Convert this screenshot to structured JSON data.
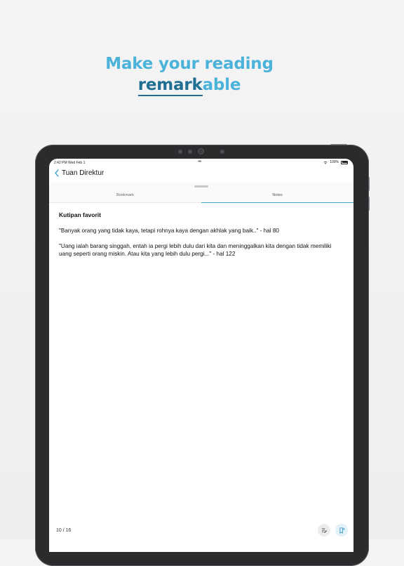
{
  "headline": {
    "line1": "Make your reading",
    "line2_mark": "remark",
    "line2_rest": "able"
  },
  "status_bar": {
    "time": "2:42 PM  Wed Feb 1",
    "dots": "•••",
    "battery": "100%"
  },
  "nav": {
    "title": "Tuan Direktur"
  },
  "tabs": [
    {
      "label": "Bookmark",
      "active": false
    },
    {
      "label": "Notes",
      "active": true
    }
  ],
  "note": {
    "title": "Kutipan favorit",
    "quotes": [
      "\"Banyak orang yang tidak kaya, tetapi rohnya kaya dengan akhlak yang baik..\" - hal 80",
      "\"Uang ialah barang singgah, entah ia pergi lebih dulu dari kita dan meninggalkan kita dengan tidak memiliki uang seperti orang miskin. Atau kita yang lebih dulu pergi...\" - hal 122"
    ]
  },
  "footer": {
    "page": "10 / 16"
  },
  "colors": {
    "accent": "#4bb3d9",
    "accent_dark": "#1f6f93",
    "tab_indicator": "#3ea7d3",
    "tablet_frame": "#2b2b2d"
  },
  "icons": {
    "back": "chevron-left-icon",
    "wifi": "wifi-icon",
    "battery": "battery-icon",
    "edit": "edit-notes-icon",
    "bookmark": "bookmark-add-icon"
  }
}
